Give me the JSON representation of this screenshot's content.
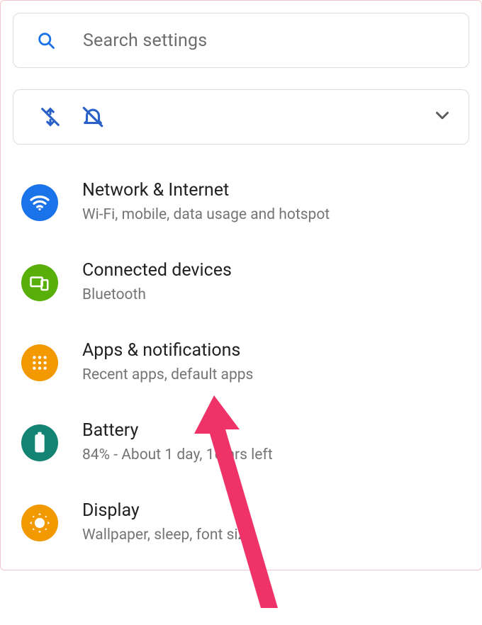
{
  "search": {
    "placeholder": "Search settings",
    "icon": "search-icon"
  },
  "quick_toggles": {
    "icons": [
      "data-off-icon",
      "bell-off-icon"
    ],
    "expand_icon": "chevron-down-icon"
  },
  "settings": [
    {
      "id": "network",
      "title": "Network & Internet",
      "subtitle": "Wi-Fi, mobile, data usage and hotspot",
      "icon": "wifi-icon",
      "color": "#1a73e8"
    },
    {
      "id": "connected",
      "title": "Connected devices",
      "subtitle": "Bluetooth",
      "icon": "devices-icon",
      "color": "#58af0a"
    },
    {
      "id": "apps",
      "title": "Apps & notifications",
      "subtitle": "Recent apps, default apps",
      "icon": "apps-grid-icon",
      "color": "#f29900"
    },
    {
      "id": "battery",
      "title": "Battery",
      "subtitle": "84% - About 1 day, 16 hrs left",
      "icon": "battery-icon",
      "color": "#138374"
    },
    {
      "id": "display",
      "title": "Display",
      "subtitle": "Wallpaper, sleep, font size",
      "icon": "brightness-icon",
      "color": "#f29900"
    }
  ],
  "annotation": {
    "type": "arrow",
    "color": "#ef3368",
    "points_to": "apps"
  }
}
